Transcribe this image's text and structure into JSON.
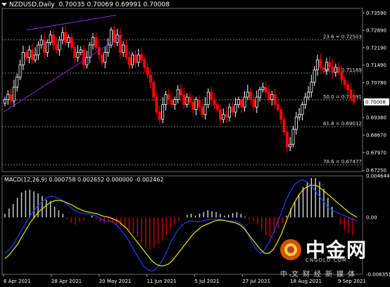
{
  "header": {
    "symbol": "NZDUSD,Daily",
    "ohlc": "0.70035 0.70069 0.69991 0.70008"
  },
  "macd_header": "MACD(12,26,9) 0.000758 0.002652 0.000000 -0.002462",
  "watermark": {
    "title": "中金网",
    "domain": "CNGOLD.COM",
    "subtitle": "中文财经新媒体"
  },
  "colors": {
    "background": "#000000",
    "bull_candle": "#ffffff",
    "bear_candle": "#ff0000",
    "trendline": "#8a2be2",
    "fib_line": "#9a9a9a",
    "macd_line": "#1f3fff",
    "signal_line": "#e8e800",
    "current_price_bg": "#ffffff"
  },
  "chart_data": [
    {
      "type": "candlestick",
      "title": "NZDUSD,Daily",
      "price_axis_ticks": [
        "0.73590",
        "0.72890",
        "0.72190",
        "0.71490",
        "0.70780",
        "0.70080",
        "0.69380",
        "0.68670",
        "0.67970",
        "0.67250"
      ],
      "ylim": [
        0.672,
        0.7377
      ],
      "time_labels": [
        "6 Apr 2021",
        "28 Apr 2021",
        "20 May 2021",
        "11 Jun 2021",
        "5 Jul 2021",
        "27 Jul 2021",
        "18 Aug 2021",
        "9 Sep 2021"
      ],
      "current_price_label": "0.70008",
      "fib_levels": [
        {
          "label": "23.6 = 0.72503",
          "value": 0.72503
        },
        {
          "label": "38.2 = 0.71169",
          "value": 0.71169
        },
        {
          "label": "50.0 = 0.70091",
          "value": 0.70091
        },
        {
          "label": "61.8 = 0.69012",
          "value": 0.69012
        },
        {
          "label": "78.6 = 0.67477",
          "value": 0.67477
        }
      ],
      "close": [
        0.701,
        0.703,
        0.7005,
        0.706,
        0.71,
        0.715,
        0.72,
        0.718,
        0.721,
        0.717,
        0.719,
        0.723,
        0.725,
        0.72,
        0.724,
        0.727,
        0.723,
        0.721,
        0.725,
        0.728,
        0.724,
        0.726,
        0.722,
        0.718,
        0.72,
        0.721,
        0.715,
        0.718,
        0.723,
        0.726,
        0.722,
        0.719,
        0.716,
        0.72,
        0.723,
        0.729,
        0.724,
        0.727,
        0.72,
        0.723,
        0.718,
        0.715,
        0.719,
        0.716,
        0.719,
        0.717,
        0.714,
        0.711,
        0.708,
        0.702,
        0.696,
        0.693,
        0.699,
        0.703,
        0.701,
        0.699,
        0.701,
        0.705,
        0.703,
        0.699,
        0.702,
        0.7,
        0.697,
        0.701,
        0.698,
        0.695,
        0.699,
        0.704,
        0.701,
        0.699,
        0.697,
        0.693,
        0.695,
        0.694,
        0.698,
        0.696,
        0.699,
        0.701,
        0.698,
        0.702,
        0.704,
        0.701,
        0.698,
        0.702,
        0.705,
        0.706,
        0.704,
        0.701,
        0.703,
        0.699,
        0.697,
        0.693,
        0.688,
        0.682,
        0.683,
        0.689,
        0.694,
        0.695,
        0.699,
        0.702,
        0.704,
        0.708,
        0.713,
        0.717,
        0.714,
        0.713,
        0.716,
        0.714,
        0.712,
        0.714,
        0.712,
        0.709,
        0.707,
        0.705,
        0.702,
        0.7001
      ],
      "macd_histogram_range": [
        -0.006351,
        0.004644
      ],
      "macd_axis_ticks": [
        "0.004644",
        "0.00",
        "-0.006351"
      ],
      "histogram": [
        0.0004,
        0.001,
        0.0015,
        0.0022,
        0.0028,
        0.003,
        0.0031,
        0.0029,
        0.0027,
        0.0024,
        0.002,
        0.0018,
        0.0012,
        0.0008,
        0.0004,
        -0.0002,
        -0.0006,
        -0.0008,
        -0.0005,
        -0.0003,
        0.0,
        0.0002,
        -0.0002,
        -0.0005,
        -0.0007,
        -0.0004,
        -0.0006,
        -0.0008,
        -0.001,
        -0.0012,
        -0.0015,
        -0.0018,
        -0.0022,
        -0.0028,
        -0.0033,
        -0.0036,
        -0.0034,
        -0.003,
        -0.0026,
        -0.002,
        -0.0012,
        -0.0008,
        -0.0004,
        0.0,
        0.0003,
        0.0004,
        0.0002,
        0.0004,
        0.0006,
        0.0008,
        0.0007,
        0.0006,
        0.0004,
        0.0002,
        0.0003,
        0.0005,
        0.0006,
        0.0004,
        0.0001,
        -0.0002,
        -0.0004,
        -0.0008,
        -0.0014,
        -0.002,
        -0.0022,
        -0.0018,
        -0.0012,
        -0.0006,
        0.0002,
        0.001,
        0.0018,
        0.0026,
        0.0034,
        0.004,
        0.0044,
        0.0044,
        0.004,
        0.0032,
        0.0022,
        0.0012,
        0.0,
        -0.0008,
        -0.0014,
        -0.0018,
        -0.002
      ],
      "macd_line": [
        -0.004,
        -0.0036,
        -0.003,
        -0.0022,
        -0.0014,
        -0.0006,
        0.0002,
        0.0008,
        0.0014,
        0.0018,
        0.0022,
        0.0024,
        0.0023,
        0.0021,
        0.0018,
        0.0014,
        0.001,
        0.0007,
        0.0005,
        0.0004,
        0.0004,
        0.0003,
        0.0001,
        -0.0002,
        -0.0004,
        -0.0004,
        -0.0006,
        -0.001,
        -0.0016,
        -0.0022,
        -0.003,
        -0.0038,
        -0.0046,
        -0.0054,
        -0.0058,
        -0.006,
        -0.0058,
        -0.0052,
        -0.0044,
        -0.0034,
        -0.0024,
        -0.0016,
        -0.001,
        -0.0006,
        -0.0004,
        -0.0004,
        -0.0005,
        -0.0004,
        -0.0003,
        -0.0002,
        -0.0002,
        -0.0002,
        -0.0003,
        -0.0004,
        -0.0004,
        -0.0004,
        -0.0006,
        -0.001,
        -0.0018,
        -0.0028,
        -0.0036,
        -0.004,
        -0.0036,
        -0.0028,
        -0.0018,
        -0.0006,
        0.0006,
        0.0018,
        0.0028,
        0.0036,
        0.004,
        0.0042,
        0.004,
        0.0036,
        0.003,
        0.0024,
        0.0018,
        0.0012,
        0.0008,
        0.0006,
        0.0004,
        0.0002,
        0.0,
        -0.0002,
        -0.0004
      ],
      "signal_line": [
        -0.0046,
        -0.0042,
        -0.0036,
        -0.003,
        -0.0022,
        -0.0014,
        -0.0006,
        0.0,
        0.0006,
        0.001,
        0.0014,
        0.0017,
        0.0019,
        0.0019,
        0.0018,
        0.0016,
        0.0014,
        0.0011,
        0.0009,
        0.0007,
        0.0006,
        0.0005,
        0.0004,
        0.0002,
        0.0001,
        0.0,
        -0.0002,
        -0.0004,
        -0.0008,
        -0.0012,
        -0.0018,
        -0.0024,
        -0.003,
        -0.0036,
        -0.0042,
        -0.0048,
        -0.0052,
        -0.0054,
        -0.0054,
        -0.0052,
        -0.0048,
        -0.0042,
        -0.0036,
        -0.003,
        -0.0024,
        -0.0018,
        -0.0014,
        -0.001,
        -0.0008,
        -0.0006,
        -0.0004,
        -0.0003,
        -0.0003,
        -0.0004,
        -0.0005,
        -0.0006,
        -0.0008,
        -0.0012,
        -0.0018,
        -0.0024,
        -0.003,
        -0.0036,
        -0.004,
        -0.004,
        -0.0036,
        -0.0028,
        -0.0018,
        -0.0006,
        0.0006,
        0.0016,
        0.0024,
        0.003,
        0.0034,
        0.0036,
        0.0036,
        0.0034,
        0.003,
        0.0026,
        0.0022,
        0.0018,
        0.0014,
        0.001,
        0.0006,
        0.0003,
        0.0
      ]
    }
  ]
}
